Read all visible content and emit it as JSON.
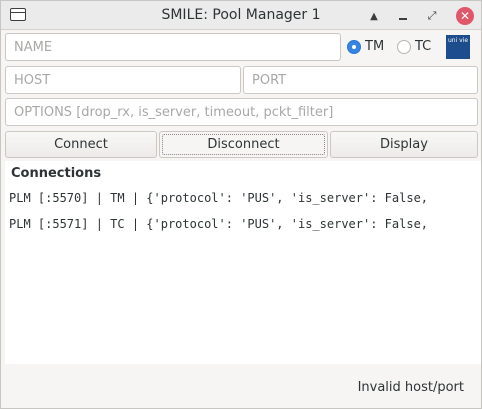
{
  "window": {
    "title": "SMILE: Pool Manager 1",
    "shade_glyph": "▲",
    "maximize_glyph": "⤢",
    "close_glyph": "✕"
  },
  "form": {
    "name_placeholder": "NAME",
    "host_placeholder": "HOST",
    "port_placeholder": "PORT",
    "options_placeholder": "OPTIONS [drop_rx, is_server, timeout, pckt_filter]",
    "radio_tm": "TM",
    "radio_tc": "TC",
    "selected": "TM",
    "logo_text": "uni vie"
  },
  "buttons": {
    "connect": "Connect",
    "disconnect": "Disconnect",
    "display": "Display"
  },
  "connections": {
    "title": "Connections",
    "lines": [
      "PLM [:5570] | TM | {'protocol': 'PUS', 'is_server': False,",
      "PLM [:5571] | TC | {'protocol': 'PUS', 'is_server': False,"
    ]
  },
  "status": "Invalid host/port",
  "colors": {
    "accent": "#3584e4",
    "close": "#e0566b",
    "logo": "#1d4d8c"
  }
}
